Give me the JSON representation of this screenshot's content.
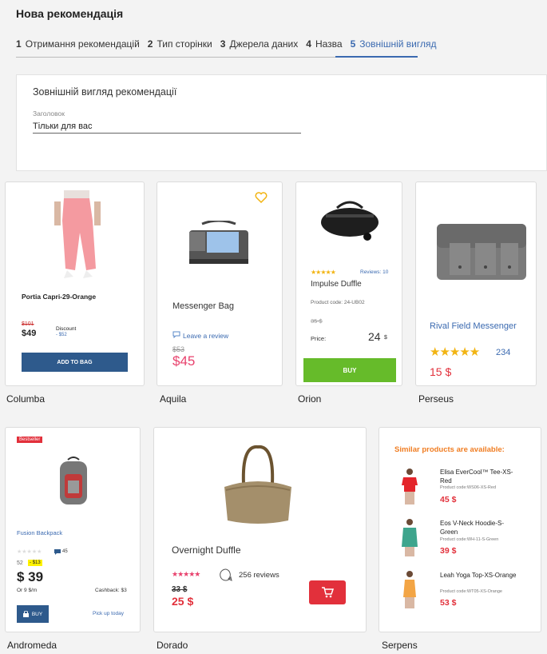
{
  "page": {
    "title": "Нова рекомендація"
  },
  "steps": [
    {
      "num": "1",
      "label": "Отримання рекомендацій"
    },
    {
      "num": "2",
      "label": "Тип сторінки"
    },
    {
      "num": "3",
      "label": "Джерела даних"
    },
    {
      "num": "4",
      "label": "Назва"
    },
    {
      "num": "5",
      "label": "Зовнішній вигляд"
    }
  ],
  "form": {
    "heading": "Зовнішній вигляд рекомендації",
    "field_label": "Заголовок",
    "field_value": "Тільки для вас"
  },
  "templates": {
    "columba": {
      "caption": "Columba",
      "name": "Portia Capri-29-Orange",
      "old_price": "$101",
      "price": "$49",
      "discount_label": "Discount",
      "discount_value": "- $52",
      "button": "ADD TO BAG"
    },
    "aquila": {
      "caption": "Aquila",
      "name": "Messenger Bag",
      "review_link": "Leave a review",
      "old_price": "$53",
      "price": "$45"
    },
    "orion": {
      "caption": "Orion",
      "reviews": "Reviews: 10",
      "name": "Impulse Duffle",
      "code": "Product code: 24-UB02",
      "old_price": "35 $",
      "price_label": "Price:",
      "price": "24",
      "currency": "$",
      "button": "BUY"
    },
    "perseus": {
      "caption": "Perseus",
      "name": "Rival Field Messenger",
      "reviews": "234",
      "price": "15 $"
    },
    "andromeda": {
      "caption": "Andromeda",
      "badge": "Bestseller",
      "name": "Fusion Backpack",
      "comments": "45",
      "old_price": "52",
      "discount": "- $13",
      "price": "$ 39",
      "installment": "Or 9 $/m",
      "cashback": "Cashback: $3",
      "button": "BUY",
      "pickup": "Pick up today"
    },
    "dorado": {
      "caption": "Dorado",
      "name": "Overnight Duffle",
      "reviews": "256 reviews",
      "old_price": "33 $",
      "price": "25 $"
    },
    "serpens": {
      "caption": "Serpens",
      "heading": "Similar products are available:",
      "items": [
        {
          "name": "Elisa EverCool™ Tee-XS-Red",
          "code": "Product code:WS06-XS-Red",
          "price": "45 $"
        },
        {
          "name": "Eos V-Neck Hoodie-S-Green",
          "code": "Product code:WH-11-S-Green",
          "price": "39 $"
        },
        {
          "name": "Leah Yoga Top-XS-Orange",
          "code": "Product code:WT05-XS-Orange",
          "price": "53 $"
        }
      ]
    }
  },
  "colors": {
    "accent": "#3b6ab0",
    "primary_button": "#2e5a8c",
    "buy_green": "#66bb2a",
    "sale_pink": "#e8426d",
    "sale_red": "#e2303b",
    "star_yellow": "#f2b413",
    "serpens_heading": "#f07d22"
  }
}
